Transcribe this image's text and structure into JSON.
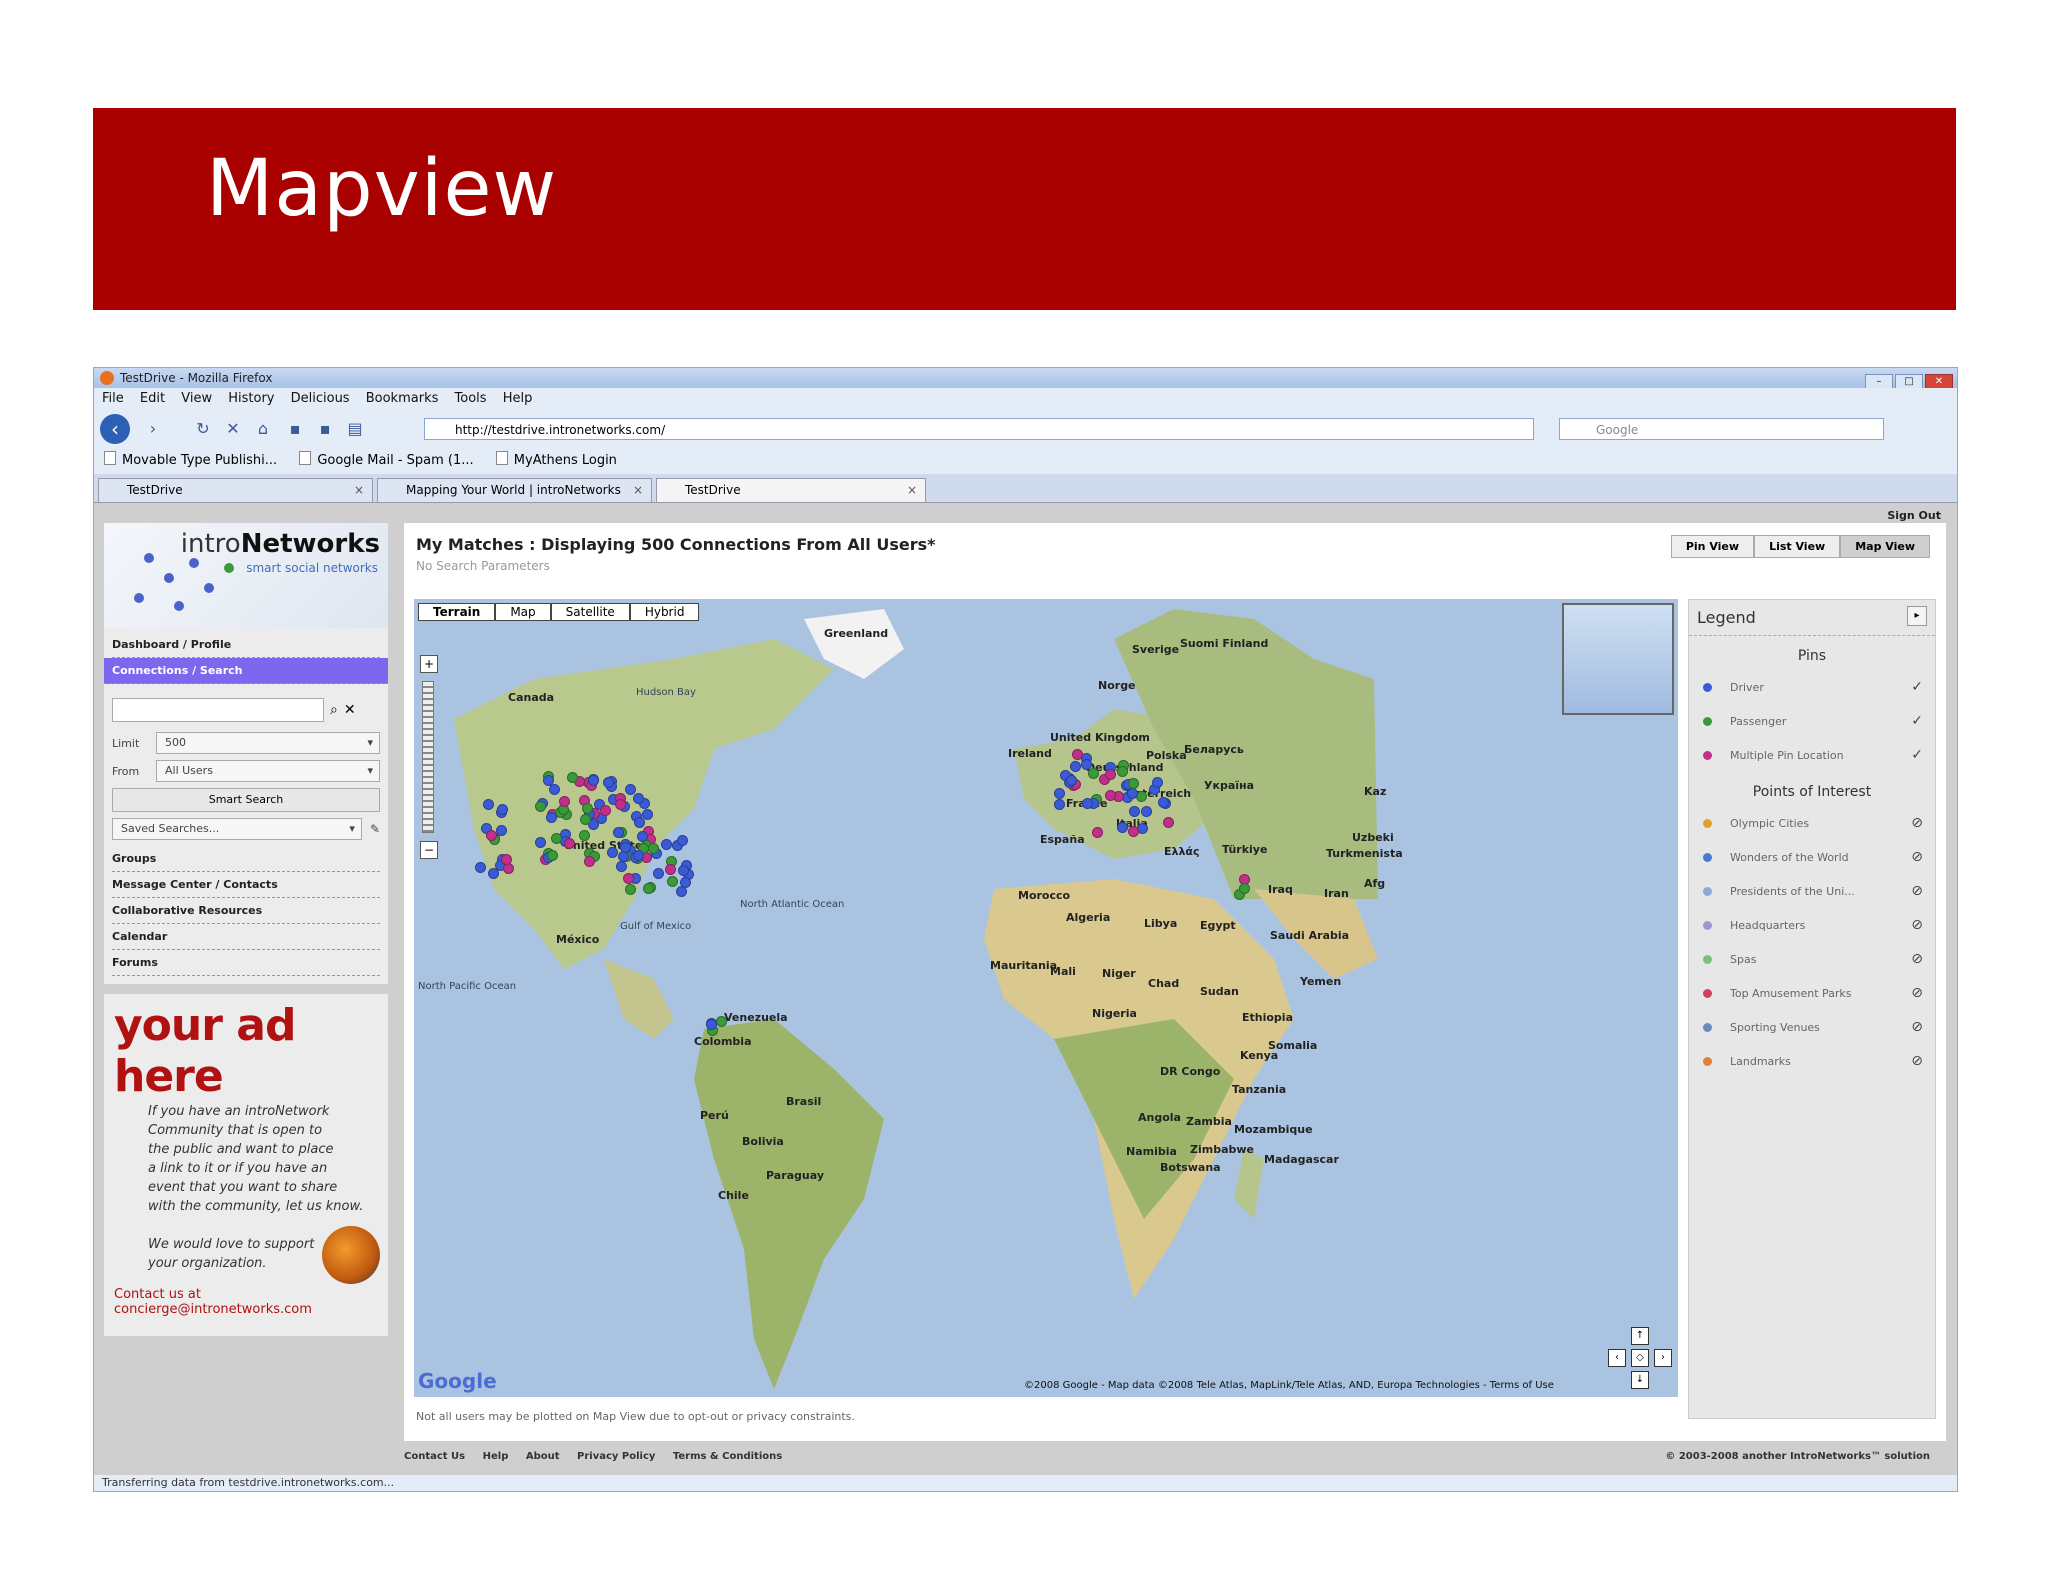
{
  "slide": {
    "title": "Mapview"
  },
  "browser": {
    "window_title": "TestDrive - Mozilla Firefox",
    "menu": [
      "File",
      "Edit",
      "View",
      "History",
      "Delicious",
      "Bookmarks",
      "Tools",
      "Help"
    ],
    "url": "http://testdrive.intronetworks.com/",
    "search_placeholder": "Google",
    "bookmarks": [
      "Movable Type Publishi...",
      "Google Mail - Spam (1...",
      "MyAthens Login"
    ],
    "tabs": [
      "TestDrive",
      "Mapping Your World | introNetworks",
      "TestDrive"
    ],
    "status": "Transferring data from testdrive.intronetworks.com..."
  },
  "page": {
    "signout": "Sign Out",
    "logo": {
      "brand_light": "intro",
      "brand_bold": "Networks",
      "tagline": "smart social networks"
    },
    "nav_top": [
      "Dashboard / Profile",
      "Connections / Search"
    ],
    "limit_label": "Limit",
    "limit_value": "500",
    "from_label": "From",
    "from_value": "All Users",
    "smart_search": "Smart Search",
    "saved_searches": "Saved Searches...",
    "nav_bottom": [
      "Groups",
      "Message Center / Contacts",
      "Collaborative Resources",
      "Calendar",
      "Forums"
    ],
    "ad": {
      "headline": "your ad here",
      "body": "If you have an introNetwork\nCommunity that is open to\nthe public and want to place\na link to it or if you have an\nevent that you want to share\nwith the community, let us know.\n\nWe would love to support\nyour organization.",
      "contact": "Contact us at\nconcierge@intronetworks.com"
    },
    "main_title": "My Matches : Displaying 500 Connections From All Users*",
    "main_sub": "No Search Parameters",
    "view_buttons": [
      "Pin View",
      "List View",
      "Map View"
    ],
    "map_types": [
      "Terrain",
      "Map",
      "Satellite",
      "Hybrid"
    ],
    "map_labels": [
      "Greenland",
      "Canada",
      "Hudson Bay",
      "United States",
      "México",
      "Gulf of Mexico",
      "North Atlantic Ocean",
      "North Pacific Ocean",
      "Venezuela",
      "Colombia",
      "Perú",
      "Brasil",
      "Bolivia",
      "Paraguay",
      "Chile",
      "Sverige",
      "Suomi Finland",
      "Norge",
      "United Kingdom",
      "Ireland",
      "Deutschland",
      "Polska",
      "France",
      "España",
      "Italia",
      "Ελλάς",
      "Türkiye",
      "Iraq",
      "Iran",
      "Algeria",
      "Libya",
      "Egypt",
      "Morocco",
      "Mauritania",
      "Mali",
      "Niger",
      "Chad",
      "Sudan",
      "Saudi Arabia",
      "Yemen",
      "Ethiopia",
      "Somalia",
      "Kenya",
      "Nigeria",
      "DR Congo",
      "Tanzania",
      "Angola",
      "Zambia",
      "Mozambique",
      "Namibia",
      "Zimbabwe",
      "Botswana",
      "Madagascar",
      "Turkmenista",
      "Uzbeki",
      "Беларусь",
      "Україна",
      "Österreich",
      "Kaz",
      "Afg"
    ],
    "map_copyright": "©2008 Google - Map data ©2008  Tele Atlas, MapLink/Tele Atlas, AND, Europa Technologies - Terms of Use",
    "google_brand": "Google",
    "footnote": "Not all users may be plotted on Map View due to opt-out or privacy constraints.",
    "legend": {
      "title": "Legend",
      "pins_heading": "Pins",
      "pins": [
        {
          "name": "Driver",
          "color": "#3b5bd6"
        },
        {
          "name": "Passenger",
          "color": "#3a9a3a"
        },
        {
          "name": "Multiple Pin Location",
          "color": "#c0308a"
        }
      ],
      "poi_heading": "Points of Interest",
      "poi": [
        {
          "name": "Olympic Cities",
          "color": "#e0a030"
        },
        {
          "name": "Wonders of the World",
          "color": "#4a7ad0"
        },
        {
          "name": "Presidents of the Uni...",
          "color": "#8fa8d8"
        },
        {
          "name": "Headquarters",
          "color": "#9a9ad0"
        },
        {
          "name": "Spas",
          "color": "#7cc07c"
        },
        {
          "name": "Top Amusement Parks",
          "color": "#d04060"
        },
        {
          "name": "Sporting Venues",
          "color": "#6a8ac0"
        },
        {
          "name": "Landmarks",
          "color": "#e08040"
        }
      ]
    },
    "footer_links": [
      "Contact Us",
      "Help",
      "About",
      "Privacy Policy",
      "Terms & Conditions"
    ],
    "footer_right": "© 2003-2008 another IntroNetworks™ solution"
  },
  "colors": {
    "slide_header": "#a90000",
    "ad_red": "#b01111",
    "nav_active": "#7b68ee"
  }
}
